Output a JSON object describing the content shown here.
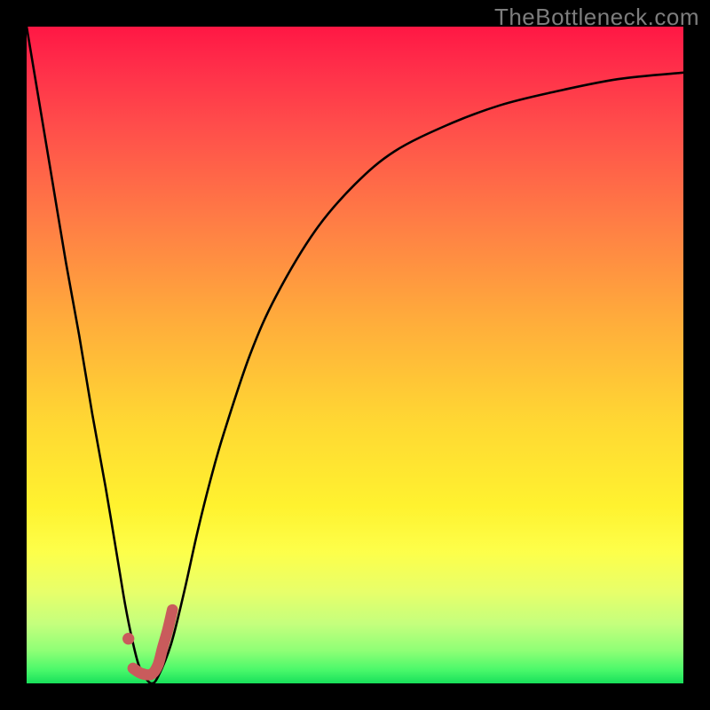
{
  "watermark": "TheBottleneck.com",
  "colors": {
    "frame": "#000000",
    "watermark": "#7d7d7d",
    "curve_stroke": "#000000",
    "marker_fill": "#c95b5c",
    "gradient_stops": [
      {
        "offset": 0.0,
        "color": "#ff1744"
      },
      {
        "offset": 0.05,
        "color": "#ff2a49"
      },
      {
        "offset": 0.15,
        "color": "#ff4d4b"
      },
      {
        "offset": 0.3,
        "color": "#ff7e45"
      },
      {
        "offset": 0.45,
        "color": "#ffad3b"
      },
      {
        "offset": 0.6,
        "color": "#ffd733"
      },
      {
        "offset": 0.73,
        "color": "#fff22f"
      },
      {
        "offset": 0.8,
        "color": "#fdff4a"
      },
      {
        "offset": 0.86,
        "color": "#e8ff6a"
      },
      {
        "offset": 0.91,
        "color": "#c4ff7d"
      },
      {
        "offset": 0.95,
        "color": "#8fff76"
      },
      {
        "offset": 0.98,
        "color": "#49f86a"
      },
      {
        "offset": 1.0,
        "color": "#18e05b"
      }
    ]
  },
  "chart_data": {
    "type": "line",
    "title": "",
    "xlabel": "",
    "ylabel": "",
    "xlim": [
      0,
      100
    ],
    "ylim": [
      0,
      100
    ],
    "series": [
      {
        "name": "curve",
        "x": [
          0,
          2,
          4,
          6,
          8,
          10,
          12,
          14,
          15,
          16,
          17,
          18,
          19,
          20,
          22,
          24,
          26,
          28,
          30,
          34,
          38,
          44,
          50,
          56,
          64,
          72,
          80,
          90,
          100
        ],
        "values": [
          100,
          88,
          76,
          64,
          53,
          41,
          30,
          18,
          12,
          7,
          3,
          1,
          0,
          1,
          6,
          14,
          23,
          31,
          38,
          50,
          59,
          69,
          76,
          81,
          85,
          88,
          90,
          92,
          93
        ]
      }
    ],
    "markers": [
      {
        "name": "dot",
        "x": 15.5,
        "y": 6.8
      },
      {
        "name": "hook_path",
        "points_x": [
          16.2,
          17.5,
          19.0,
          20.0,
          20.7,
          21.5,
          22.2
        ],
        "points_y": [
          2.3,
          1.5,
          1.4,
          2.8,
          5.4,
          8.2,
          11.2
        ]
      }
    ]
  }
}
